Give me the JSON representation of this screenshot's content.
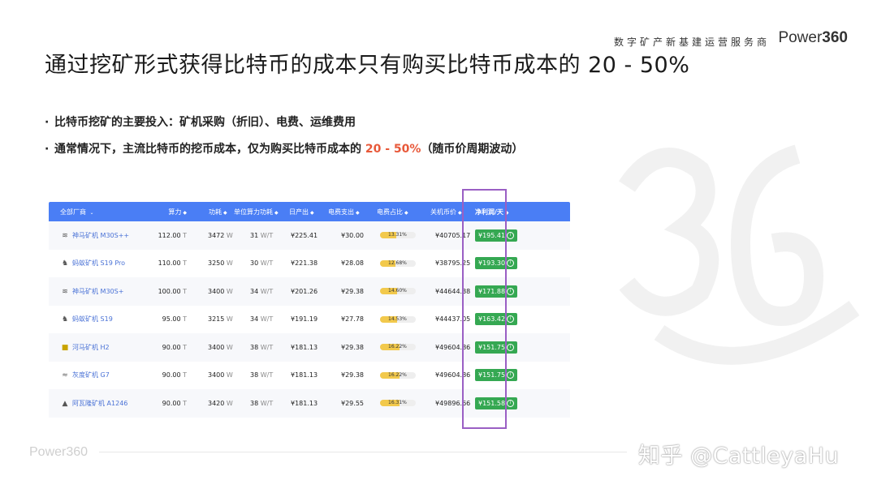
{
  "header": {
    "tagline": "数字矿产新基建运营服务商",
    "brand_prefix": "Power",
    "brand_suffix": "360"
  },
  "title": "通过挖矿形式获得比特币的成本只有购买比特币成本的 20 - 50%",
  "bullets": {
    "b1": "比特币挖矿的主要投入：矿机采购（折旧）、电费、运维费用",
    "b2_pre": "通常情况下，主流比特币的挖币成本，仅为购买比特币成本的 ",
    "b2_hl": "20 - 50%",
    "b2_post": "（随币价周期波动）"
  },
  "table": {
    "headers": {
      "vendor": "全部厂商",
      "hashrate": "算力",
      "power": "功耗",
      "efficiency": "单位算力功耗",
      "daily_output": "日产出",
      "elec_cost": "电费支出",
      "elec_ratio": "电费占比",
      "shutdown_price": "关机币价",
      "net_profit": "净利润/天"
    },
    "rows": [
      {
        "name": "神马矿机 M30S++",
        "icon": "whatsminer-icon",
        "hashrate": "112.00",
        "hash_unit": "T",
        "power": "3472",
        "power_unit": "W",
        "eff": "31",
        "eff_unit": "W/T",
        "output": "¥225.41",
        "elec": "¥30.00",
        "ratio": "13.31%",
        "ratio_val": 0.1331,
        "price": "¥40705.17",
        "profit": "¥195.41"
      },
      {
        "name": "蚂蚁矿机 S19 Pro",
        "icon": "antminer-icon",
        "hashrate": "110.00",
        "hash_unit": "T",
        "power": "3250",
        "power_unit": "W",
        "eff": "30",
        "eff_unit": "W/T",
        "output": "¥221.38",
        "elec": "¥28.08",
        "ratio": "12.68%",
        "ratio_val": 0.1268,
        "price": "¥38795.25",
        "profit": "¥193.30"
      },
      {
        "name": "神马矿机 M30S+",
        "icon": "whatsminer-icon",
        "hashrate": "100.00",
        "hash_unit": "T",
        "power": "3400",
        "power_unit": "W",
        "eff": "34",
        "eff_unit": "W/T",
        "output": "¥201.26",
        "elec": "¥29.38",
        "ratio": "14.60%",
        "ratio_val": 0.146,
        "price": "¥44644.38",
        "profit": "¥171.88"
      },
      {
        "name": "蚂蚁矿机 S19",
        "icon": "antminer-icon",
        "hashrate": "95.00",
        "hash_unit": "T",
        "power": "3215",
        "power_unit": "W",
        "eff": "34",
        "eff_unit": "W/T",
        "output": "¥191.19",
        "elec": "¥27.78",
        "ratio": "14.53%",
        "ratio_val": 0.1453,
        "price": "¥44437.05",
        "profit": "¥163.42"
      },
      {
        "name": "河马矿机 H2",
        "icon": "hippo-icon",
        "hashrate": "90.00",
        "hash_unit": "T",
        "power": "3400",
        "power_unit": "W",
        "eff": "38",
        "eff_unit": "W/T",
        "output": "¥181.13",
        "elec": "¥29.38",
        "ratio": "16.22%",
        "ratio_val": 0.1622,
        "price": "¥49604.86",
        "profit": "¥151.75"
      },
      {
        "name": "灰度矿机 G7",
        "icon": "grayscale-icon",
        "hashrate": "90.00",
        "hash_unit": "T",
        "power": "3400",
        "power_unit": "W",
        "eff": "38",
        "eff_unit": "W/T",
        "output": "¥181.13",
        "elec": "¥29.38",
        "ratio": "16.22%",
        "ratio_val": 0.1622,
        "price": "¥49604.86",
        "profit": "¥151.75"
      },
      {
        "name": "阿瓦隆矿机 A1246",
        "icon": "avalon-icon",
        "hashrate": "90.00",
        "hash_unit": "T",
        "power": "3420",
        "power_unit": "W",
        "eff": "38",
        "eff_unit": "W/T",
        "output": "¥181.13",
        "elec": "¥29.55",
        "ratio": "16.31%",
        "ratio_val": 0.1631,
        "price": "¥49896.66",
        "profit": "¥151.58"
      }
    ]
  },
  "footer": {
    "logo": "Power360",
    "watermark": "知乎 @CattleyaHu"
  },
  "colors": {
    "header_blue": "#4a7ef5",
    "profit_green": "#35a852",
    "highlight": "#e8593a",
    "box_purple": "#9a5fc4"
  }
}
